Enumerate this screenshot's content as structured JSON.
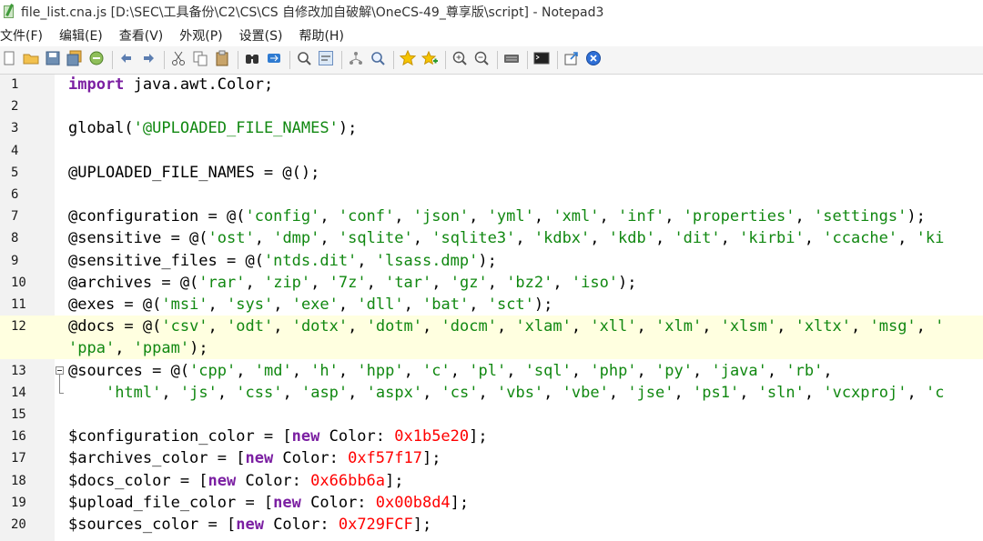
{
  "window": {
    "title": "file_list.cna.js [D:\\SEC\\工具备份\\C2\\CS\\CS 自修改加自破解\\OneCS-49_尊享版\\script] - Notepad3"
  },
  "menu": [
    {
      "label": "文件(F)"
    },
    {
      "label": "编辑(E)"
    },
    {
      "label": "查看(V)"
    },
    {
      "label": "外观(P)"
    },
    {
      "label": "设置(S)"
    },
    {
      "label": "帮助(H)"
    }
  ],
  "toolbar": [
    {
      "icon": "new-file-icon"
    },
    {
      "icon": "open-folder-icon"
    },
    {
      "icon": "save-icon"
    },
    {
      "icon": "save-all-icon"
    },
    {
      "icon": "browse-icon"
    },
    {
      "sep": true
    },
    {
      "icon": "undo-icon"
    },
    {
      "icon": "redo-icon"
    },
    {
      "sep": true
    },
    {
      "icon": "cut-icon"
    },
    {
      "icon": "copy-icon"
    },
    {
      "icon": "paste-icon"
    },
    {
      "sep": true
    },
    {
      "icon": "find-icon"
    },
    {
      "icon": "replace-icon"
    },
    {
      "sep": true
    },
    {
      "icon": "find-next-icon"
    },
    {
      "icon": "word-wrap-icon"
    },
    {
      "sep": true
    },
    {
      "icon": "tree-icon"
    },
    {
      "icon": "search-text-icon"
    },
    {
      "sep": true
    },
    {
      "icon": "star-icon"
    },
    {
      "icon": "star-plus-icon"
    },
    {
      "sep": true
    },
    {
      "icon": "zoom-in-icon"
    },
    {
      "icon": "zoom-out-icon"
    },
    {
      "sep": true
    },
    {
      "icon": "keyboard-icon"
    },
    {
      "sep": true
    },
    {
      "icon": "terminal-icon"
    },
    {
      "sep": true
    },
    {
      "icon": "export-icon"
    },
    {
      "icon": "close-circle-icon"
    }
  ],
  "editor": {
    "current_line": 12,
    "lines": [
      {
        "no": "1",
        "tokens": [
          {
            "t": "import",
            "c": "kw"
          },
          {
            "t": " java.awt.Color;",
            "c": ""
          }
        ]
      },
      {
        "no": "2",
        "tokens": []
      },
      {
        "no": "3",
        "tokens": [
          {
            "t": "global(",
            "c": ""
          },
          {
            "t": "'@UPLOADED_FILE_NAMES'",
            "c": "str"
          },
          {
            "t": ");",
            "c": ""
          }
        ]
      },
      {
        "no": "4",
        "tokens": []
      },
      {
        "no": "5",
        "tokens": [
          {
            "t": "@UPLOADED_FILE_NAMES = @();",
            "c": ""
          }
        ]
      },
      {
        "no": "6",
        "tokens": []
      },
      {
        "no": "7",
        "tokens": [
          {
            "t": "@configuration = @(",
            "c": ""
          },
          {
            "t": "'config'",
            "c": "str"
          },
          {
            "t": ", ",
            "c": ""
          },
          {
            "t": "'conf'",
            "c": "str"
          },
          {
            "t": ", ",
            "c": ""
          },
          {
            "t": "'json'",
            "c": "str"
          },
          {
            "t": ", ",
            "c": ""
          },
          {
            "t": "'yml'",
            "c": "str"
          },
          {
            "t": ", ",
            "c": ""
          },
          {
            "t": "'xml'",
            "c": "str"
          },
          {
            "t": ", ",
            "c": ""
          },
          {
            "t": "'inf'",
            "c": "str"
          },
          {
            "t": ", ",
            "c": ""
          },
          {
            "t": "'properties'",
            "c": "str"
          },
          {
            "t": ", ",
            "c": ""
          },
          {
            "t": "'settings'",
            "c": "str"
          },
          {
            "t": ");",
            "c": ""
          }
        ]
      },
      {
        "no": "8",
        "tokens": [
          {
            "t": "@sensitive = @(",
            "c": ""
          },
          {
            "t": "'ost'",
            "c": "str"
          },
          {
            "t": ", ",
            "c": ""
          },
          {
            "t": "'dmp'",
            "c": "str"
          },
          {
            "t": ", ",
            "c": ""
          },
          {
            "t": "'sqlite'",
            "c": "str"
          },
          {
            "t": ", ",
            "c": ""
          },
          {
            "t": "'sqlite3'",
            "c": "str"
          },
          {
            "t": ", ",
            "c": ""
          },
          {
            "t": "'kdbx'",
            "c": "str"
          },
          {
            "t": ", ",
            "c": ""
          },
          {
            "t": "'kdb'",
            "c": "str"
          },
          {
            "t": ", ",
            "c": ""
          },
          {
            "t": "'dit'",
            "c": "str"
          },
          {
            "t": ", ",
            "c": ""
          },
          {
            "t": "'kirbi'",
            "c": "str"
          },
          {
            "t": ", ",
            "c": ""
          },
          {
            "t": "'ccache'",
            "c": "str"
          },
          {
            "t": ", ",
            "c": ""
          },
          {
            "t": "'ki",
            "c": "str"
          }
        ]
      },
      {
        "no": "9",
        "tokens": [
          {
            "t": "@sensitive_files = @(",
            "c": ""
          },
          {
            "t": "'ntds.dit'",
            "c": "str"
          },
          {
            "t": ", ",
            "c": ""
          },
          {
            "t": "'lsass.dmp'",
            "c": "str"
          },
          {
            "t": ");",
            "c": ""
          }
        ]
      },
      {
        "no": "10",
        "tokens": [
          {
            "t": "@archives = @(",
            "c": ""
          },
          {
            "t": "'rar'",
            "c": "str"
          },
          {
            "t": ", ",
            "c": ""
          },
          {
            "t": "'zip'",
            "c": "str"
          },
          {
            "t": ", ",
            "c": ""
          },
          {
            "t": "'7z'",
            "c": "str"
          },
          {
            "t": ", ",
            "c": ""
          },
          {
            "t": "'tar'",
            "c": "str"
          },
          {
            "t": ", ",
            "c": ""
          },
          {
            "t": "'gz'",
            "c": "str"
          },
          {
            "t": ", ",
            "c": ""
          },
          {
            "t": "'bz2'",
            "c": "str"
          },
          {
            "t": ", ",
            "c": ""
          },
          {
            "t": "'iso'",
            "c": "str"
          },
          {
            "t": ");",
            "c": ""
          }
        ]
      },
      {
        "no": "11",
        "tokens": [
          {
            "t": "@exes = @(",
            "c": ""
          },
          {
            "t": "'msi'",
            "c": "str"
          },
          {
            "t": ", ",
            "c": ""
          },
          {
            "t": "'sys'",
            "c": "str"
          },
          {
            "t": ", ",
            "c": ""
          },
          {
            "t": "'exe'",
            "c": "str"
          },
          {
            "t": ", ",
            "c": ""
          },
          {
            "t": "'dll'",
            "c": "str"
          },
          {
            "t": ", ",
            "c": ""
          },
          {
            "t": "'bat'",
            "c": "str"
          },
          {
            "t": ", ",
            "c": ""
          },
          {
            "t": "'sct'",
            "c": "str"
          },
          {
            "t": ");",
            "c": ""
          }
        ]
      },
      {
        "no": "12",
        "tokens": [
          {
            "t": "@docs = @(",
            "c": ""
          },
          {
            "t": "'csv'",
            "c": "str"
          },
          {
            "t": ", ",
            "c": ""
          },
          {
            "t": "'odt'",
            "c": "str"
          },
          {
            "t": ", ",
            "c": ""
          },
          {
            "t": "'dotx'",
            "c": "str"
          },
          {
            "t": ", ",
            "c": ""
          },
          {
            "t": "'dotm'",
            "c": "str"
          },
          {
            "t": ", ",
            "c": ""
          },
          {
            "t": "'docm'",
            "c": "str"
          },
          {
            "t": ", ",
            "c": ""
          },
          {
            "t": "'xlam'",
            "c": "str"
          },
          {
            "t": ", ",
            "c": ""
          },
          {
            "t": "'xll'",
            "c": "str"
          },
          {
            "t": ", ",
            "c": ""
          },
          {
            "t": "'xlm'",
            "c": "str"
          },
          {
            "t": ", ",
            "c": ""
          },
          {
            "t": "'xlsm'",
            "c": "str"
          },
          {
            "t": ", ",
            "c": ""
          },
          {
            "t": "'xltx'",
            "c": "str"
          },
          {
            "t": ", ",
            "c": ""
          },
          {
            "t": "'msg'",
            "c": "str"
          },
          {
            "t": ", ",
            "c": ""
          },
          {
            "t": "'",
            "c": "str"
          }
        ]
      },
      {
        "no": "",
        "tokens": [
          {
            "t": "'ppa'",
            "c": "str"
          },
          {
            "t": ", ",
            "c": ""
          },
          {
            "t": "'ppam'",
            "c": "str"
          },
          {
            "t": ");",
            "c": ""
          }
        ]
      },
      {
        "no": "13",
        "tokens": [
          {
            "t": "@sources = @(",
            "c": ""
          },
          {
            "t": "'cpp'",
            "c": "str"
          },
          {
            "t": ", ",
            "c": ""
          },
          {
            "t": "'md'",
            "c": "str"
          },
          {
            "t": ", ",
            "c": ""
          },
          {
            "t": "'h'",
            "c": "str"
          },
          {
            "t": ", ",
            "c": ""
          },
          {
            "t": "'hpp'",
            "c": "str"
          },
          {
            "t": ", ",
            "c": ""
          },
          {
            "t": "'c'",
            "c": "str"
          },
          {
            "t": ", ",
            "c": ""
          },
          {
            "t": "'pl'",
            "c": "str"
          },
          {
            "t": ", ",
            "c": ""
          },
          {
            "t": "'sql'",
            "c": "str"
          },
          {
            "t": ", ",
            "c": ""
          },
          {
            "t": "'php'",
            "c": "str"
          },
          {
            "t": ", ",
            "c": ""
          },
          {
            "t": "'py'",
            "c": "str"
          },
          {
            "t": ", ",
            "c": ""
          },
          {
            "t": "'java'",
            "c": "str"
          },
          {
            "t": ", ",
            "c": ""
          },
          {
            "t": "'rb'",
            "c": "str"
          },
          {
            "t": ",",
            "c": ""
          }
        ]
      },
      {
        "no": "14",
        "tokens": [
          {
            "t": "    ",
            "c": ""
          },
          {
            "t": "'html'",
            "c": "str"
          },
          {
            "t": ", ",
            "c": ""
          },
          {
            "t": "'js'",
            "c": "str"
          },
          {
            "t": ", ",
            "c": ""
          },
          {
            "t": "'css'",
            "c": "str"
          },
          {
            "t": ", ",
            "c": ""
          },
          {
            "t": "'asp'",
            "c": "str"
          },
          {
            "t": ", ",
            "c": ""
          },
          {
            "t": "'aspx'",
            "c": "str"
          },
          {
            "t": ", ",
            "c": ""
          },
          {
            "t": "'cs'",
            "c": "str"
          },
          {
            "t": ", ",
            "c": ""
          },
          {
            "t": "'vbs'",
            "c": "str"
          },
          {
            "t": ", ",
            "c": ""
          },
          {
            "t": "'vbe'",
            "c": "str"
          },
          {
            "t": ", ",
            "c": ""
          },
          {
            "t": "'jse'",
            "c": "str"
          },
          {
            "t": ", ",
            "c": ""
          },
          {
            "t": "'ps1'",
            "c": "str"
          },
          {
            "t": ", ",
            "c": ""
          },
          {
            "t": "'sln'",
            "c": "str"
          },
          {
            "t": ", ",
            "c": ""
          },
          {
            "t": "'vcxproj'",
            "c": "str"
          },
          {
            "t": ", ",
            "c": ""
          },
          {
            "t": "'c",
            "c": "str"
          }
        ]
      },
      {
        "no": "15",
        "tokens": []
      },
      {
        "no": "16",
        "tokens": [
          {
            "t": "$configuration_color = [",
            "c": ""
          },
          {
            "t": "new",
            "c": "kw"
          },
          {
            "t": " Color: ",
            "c": ""
          },
          {
            "t": "0x1b5e20",
            "c": "num"
          },
          {
            "t": "];",
            "c": ""
          }
        ]
      },
      {
        "no": "17",
        "tokens": [
          {
            "t": "$archives_color = [",
            "c": ""
          },
          {
            "t": "new",
            "c": "kw"
          },
          {
            "t": " Color: ",
            "c": ""
          },
          {
            "t": "0xf57f17",
            "c": "num"
          },
          {
            "t": "];",
            "c": ""
          }
        ]
      },
      {
        "no": "18",
        "tokens": [
          {
            "t": "$docs_color = [",
            "c": ""
          },
          {
            "t": "new",
            "c": "kw"
          },
          {
            "t": " Color: ",
            "c": ""
          },
          {
            "t": "0x66bb6a",
            "c": "num"
          },
          {
            "t": "];",
            "c": ""
          }
        ]
      },
      {
        "no": "19",
        "tokens": [
          {
            "t": "$upload_file_color = [",
            "c": ""
          },
          {
            "t": "new",
            "c": "kw"
          },
          {
            "t": " Color: ",
            "c": ""
          },
          {
            "t": "0x00b8d4",
            "c": "num"
          },
          {
            "t": "];",
            "c": ""
          }
        ]
      },
      {
        "no": "20",
        "tokens": [
          {
            "t": "$sources_color = [",
            "c": ""
          },
          {
            "t": "new",
            "c": "kw"
          },
          {
            "t": " Color: ",
            "c": ""
          },
          {
            "t": "0x729FCF",
            "c": "num"
          },
          {
            "t": "];",
            "c": ""
          }
        ]
      }
    ]
  }
}
